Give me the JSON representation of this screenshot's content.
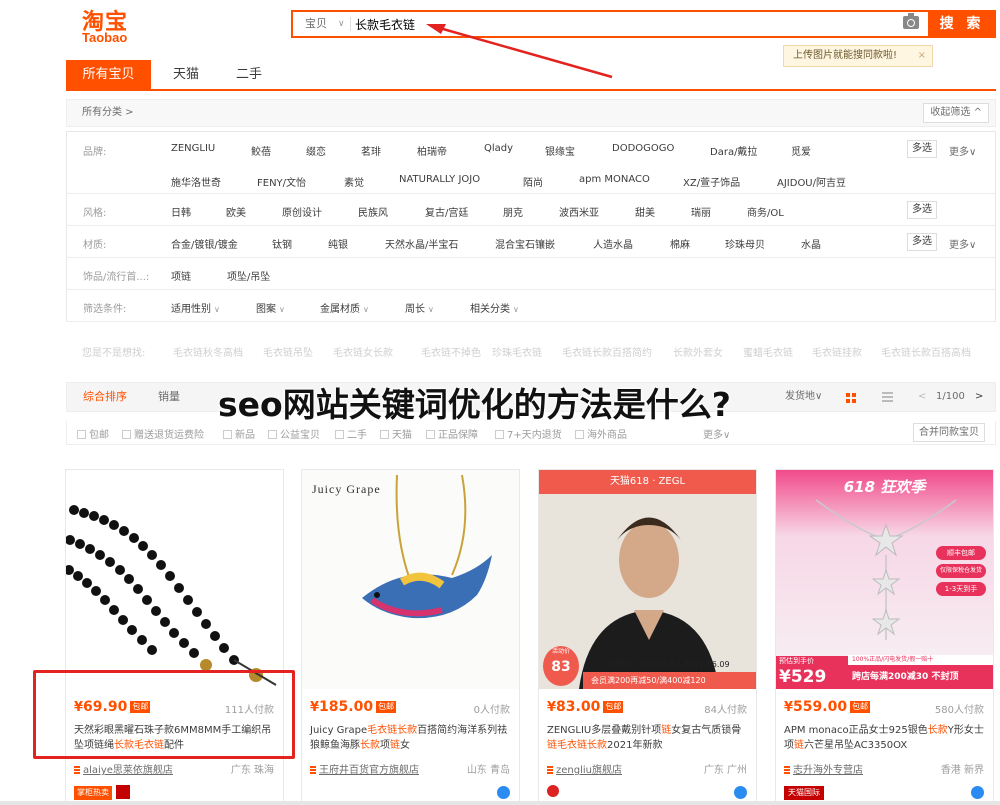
{
  "logo": {
    "cn": "淘宝",
    "en": "Taobao"
  },
  "search": {
    "scope": "宝贝",
    "query": "长款毛衣链",
    "button": "搜 索",
    "tip": "上传图片就能搜同款啦!"
  },
  "main_tabs": [
    "所有宝贝",
    "天猫",
    "二手"
  ],
  "crumb": "所有分类 >",
  "fold_label": "收起筛选",
  "filters": {
    "brand": {
      "label": "品牌:",
      "row1": [
        "ZENGLIU",
        "鲛蓓",
        "缀恋",
        "茗琲",
        "柏瑞帝",
        "Qlady",
        "银缘宝",
        "DODOGOGO",
        "Dara/戴拉",
        "觅爱"
      ],
      "row2": [
        "施华洛世奇",
        "FENY/文怡",
        "素觉",
        "NATURALLY JOJO",
        "陌尚",
        "apm MONACO",
        "XZ/萱子饰品",
        "AJIDOU/阿吉豆"
      ]
    },
    "style": {
      "label": "风格:",
      "options": [
        "日韩",
        "欧美",
        "原创设计",
        "民族风",
        "复古/宫廷",
        "朋克",
        "波西米亚",
        "甜美",
        "瑞丽",
        "商务/OL"
      ]
    },
    "material": {
      "label": "材质:",
      "options": [
        "合金/镀银/镀金",
        "钛钢",
        "纯银",
        "天然水晶/半宝石",
        "混合宝石镶嵌",
        "人造水晶",
        "棉麻",
        "珍珠母贝",
        "水晶"
      ]
    },
    "category": {
      "label": "饰品/流行首...:",
      "options": [
        "项链",
        "项坠/吊坠"
      ]
    },
    "conditions": {
      "label": "筛选条件:",
      "options": [
        "适用性别",
        "图案",
        "金属材质",
        "周长",
        "相关分类"
      ]
    },
    "multi_label": "多选",
    "more_label": "更多"
  },
  "guess": {
    "label": "您是不是想找:",
    "items": [
      "毛衣链秋冬高档",
      "毛衣链吊坠",
      "毛衣链女长款",
      "毛衣链不掉色",
      "珍珠毛衣链",
      "毛衣链长款百搭简约",
      "长款外套女",
      "蜜蜡毛衣链",
      "毛衣链挂款",
      "毛衣链长款百搭高档"
    ]
  },
  "sort": {
    "tabs": [
      "综合排序",
      "销量"
    ],
    "location": "发货地",
    "page": "1/100"
  },
  "checks": [
    "包邮",
    "赠送退货运费险",
    "新品",
    "公益宝贝",
    "二手",
    "天猫",
    "正品保障",
    "7+天内退货",
    "海外商品"
  ],
  "checks_more": "更多",
  "merge_label": "合并同款宝贝",
  "overlay_title": "seo网站关键词优化的方法是什么?",
  "products": [
    {
      "price_sym": "¥",
      "price": "69.90",
      "pkg": "包邮",
      "paid": "111人付款",
      "title_parts": [
        "天然彩眼黑曜石珠子款6MM8MM手工编织吊坠项链绳",
        "长款毛衣链",
        "配件"
      ],
      "shop": "alaiye思莱依旗舰店",
      "location": "广东 珠海",
      "badge": "掌柜热卖"
    },
    {
      "price_sym": "¥",
      "price": "185.00",
      "pkg": "包邮",
      "paid": "0人付款",
      "title_parts": [
        "Juicy Grape",
        "毛衣链长款",
        "百搭简约海洋系列祛狼鲸鱼海豚",
        "长款",
        "项",
        "链",
        "女"
      ],
      "shop": "王府井百货官方旗舰店",
      "location": "山东 青岛",
      "img_text": "Juicy Grape"
    },
    {
      "price_sym": "¥",
      "price": "83.00",
      "pkg": "包邮",
      "paid": "84人付款",
      "title_parts": [
        "ZENGLIU多层叠戴别针项",
        "链",
        "女复古气质锁骨",
        "链毛衣链长款",
        "2021年新款"
      ],
      "shop": "zengliu旗舰店",
      "location": "广东 广州",
      "img_top": "天猫618 · ZEGL",
      "img_price": "83",
      "img_tag": "活动价",
      "img_date": "DATE: 2021.06.07-2021.06.09",
      "img_promo": "会员满200再减50/满400减120"
    },
    {
      "price_sym": "¥",
      "price": "559.00",
      "pkg": "包邮",
      "paid": "580人付款",
      "title_parts": [
        "APM monaco正品女士925银色",
        "长款",
        "Y形女士项",
        "链",
        "六芒星吊坠AC3350OX"
      ],
      "shop": "志升海外专营店",
      "location": "香港 新界",
      "badge": "天猫国际",
      "img_top": "618 狂欢季",
      "img_price": "¥529",
      "img_tag1": "顺丰包邮",
      "img_tag2": "仅限保税仓发货",
      "img_tag3": "1-3天到手",
      "img_strip": "100%正品/闪电发货/假一赔十",
      "img_prebuy": "预估到手价",
      "img_cross": "跨店每满200减30 不封顶"
    }
  ],
  "colors": {
    "accent": "#ff5000",
    "highlight": "#e3231f"
  }
}
